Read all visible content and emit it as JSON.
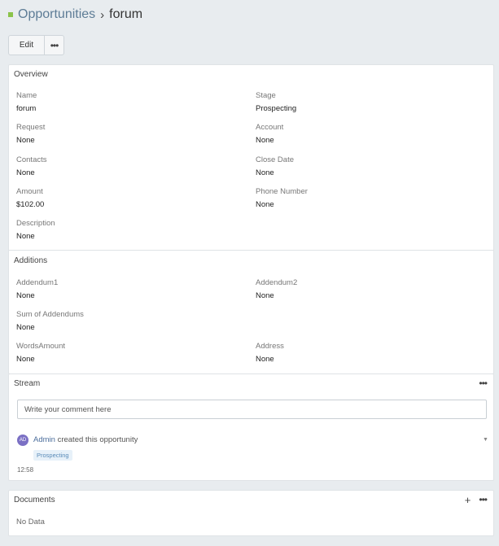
{
  "breadcrumb": {
    "parent": "Opportunities",
    "separator": "›",
    "current": "forum"
  },
  "toolbar": {
    "edit_label": "Edit",
    "more_label": "•••"
  },
  "overview": {
    "title": "Overview",
    "fields": {
      "name": {
        "label": "Name",
        "value": "forum"
      },
      "stage": {
        "label": "Stage",
        "value": "Prospecting"
      },
      "request": {
        "label": "Request",
        "value": "None"
      },
      "account": {
        "label": "Account",
        "value": "None"
      },
      "contacts": {
        "label": "Contacts",
        "value": "None"
      },
      "close_date": {
        "label": "Close Date",
        "value": "None"
      },
      "amount": {
        "label": "Amount",
        "value": "$102.00"
      },
      "phone": {
        "label": "Phone Number",
        "value": "None"
      },
      "description": {
        "label": "Description",
        "value": "None"
      }
    }
  },
  "additions": {
    "title": "Additions",
    "fields": {
      "addendum1": {
        "label": "Addendum1",
        "value": "None"
      },
      "addendum2": {
        "label": "Addendum2",
        "value": "None"
      },
      "sum": {
        "label": "Sum of Addendums",
        "value": "None"
      },
      "words_amount": {
        "label": "WordsAmount",
        "value": "None"
      },
      "address": {
        "label": "Address",
        "value": "None"
      }
    }
  },
  "stream": {
    "title": "Stream",
    "more_label": "•••",
    "comment_placeholder": "Write your comment here",
    "entry": {
      "avatar": "AD",
      "user": "Admin",
      "text": " created this opportunity",
      "badge": "Prospecting",
      "time": "12:58",
      "caret": "▼"
    }
  },
  "documents": {
    "title": "Documents",
    "plus_label": "+",
    "more_label": "•••",
    "empty": "No Data"
  },
  "colors": {
    "accent": "#8bc34a",
    "link": "#5d7c96",
    "avatar": "#7b70c4"
  }
}
